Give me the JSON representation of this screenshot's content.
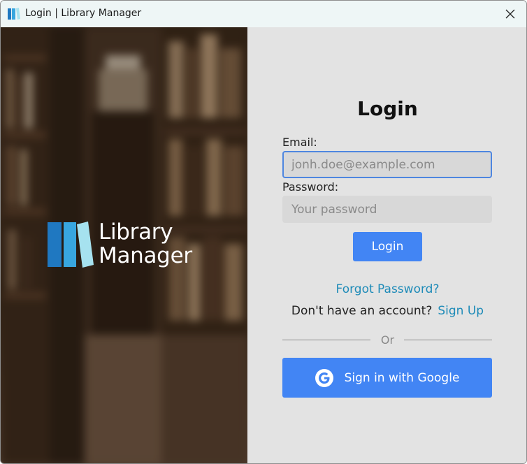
{
  "window": {
    "title": "Login | Library Manager"
  },
  "brand": {
    "logo_line1": "Library",
    "logo_line2": "Manager",
    "colors": {
      "dark_blue": "#1f78c1",
      "mid_blue": "#38a6df",
      "light_blue": "#a6e2ef"
    }
  },
  "form": {
    "heading": "Login",
    "email_label": "Email:",
    "email_placeholder": "jonh.doe@example.com",
    "password_label": "Password:",
    "password_placeholder": "Your password",
    "login_button": "Login",
    "forgot_link": "Forgot Password?",
    "signup_question": "Don't have an account?",
    "signup_link": "Sign Up",
    "divider_text": "Or",
    "google_button": "Sign in with Google"
  },
  "colors": {
    "accent": "#4285f4",
    "link": "#1e8bb8",
    "panel_bg": "#e3e3e3"
  }
}
